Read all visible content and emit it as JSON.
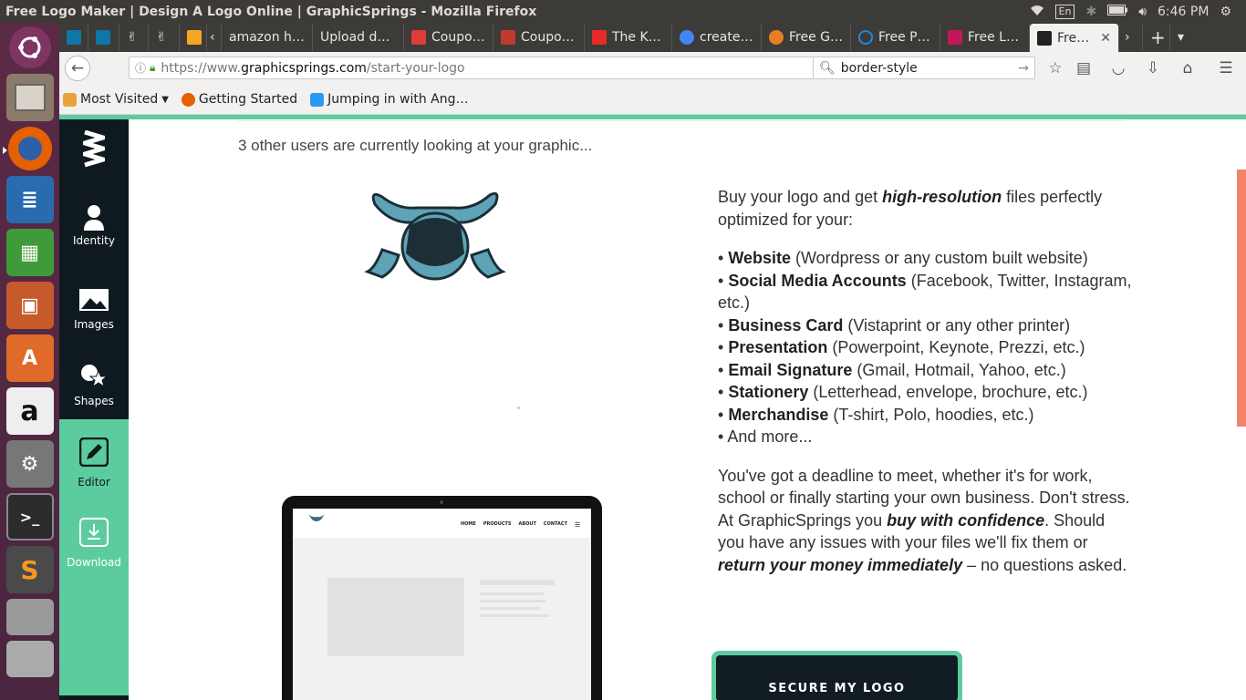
{
  "panel": {
    "window_title": "Free Logo Maker | Design A Logo Online | GraphicSprings - Mozilla Firefox",
    "keyboard": "En",
    "time": "6:46 PM"
  },
  "tabs": [
    {
      "label": "",
      "color": "#0e76a8"
    },
    {
      "label": "",
      "color": "#0e76a8"
    },
    {
      "label": "",
      "color": "#555"
    },
    {
      "label": "",
      "color": "#555"
    },
    {
      "label": "",
      "color": "#f5a623"
    },
    {
      "label": "amazon h…",
      "color": "#333"
    },
    {
      "label": "Upload d…",
      "color": "#333"
    },
    {
      "label": "Coupo…",
      "color": "#e03b3b"
    },
    {
      "label": "Coupo…",
      "color": "#c0392b"
    },
    {
      "label": "The K…",
      "color": "#e52d27"
    },
    {
      "label": "create…",
      "color": "#4285f4"
    },
    {
      "label": "Free G…",
      "color": "#e67e22"
    },
    {
      "label": "Free P…",
      "color": "#1e88e5"
    },
    {
      "label": "Free L…",
      "color": "#c2185b"
    },
    {
      "label": "Fre…",
      "color": "#222"
    }
  ],
  "nav": {
    "url_prefix": "https://www.",
    "url_domain": "graphicsprings.com",
    "url_path": "/start-your-logo",
    "search_value": "border-style"
  },
  "bookmarks": {
    "most_visited": "Most Visited",
    "getting_started": "Getting Started",
    "angular": "Jumping in with Ang…"
  },
  "sidebar": {
    "identity": "Identity",
    "images": "Images",
    "shapes": "Shapes",
    "editor": "Editor",
    "download": "Download"
  },
  "content": {
    "viewers": "3 other users are currently looking at your graphic...",
    "intro_1": "Buy your logo and get ",
    "intro_bold": "high-resolution",
    "intro_2": " files perfectly optimized for your:",
    "features": [
      {
        "bold": "Website",
        "rest": " (Wordpress or any custom built website)"
      },
      {
        "bold": "Social Media Accounts",
        "rest": " (Facebook, Twitter, Instagram, etc.)"
      },
      {
        "bold": "Business Card",
        "rest": " (Vistaprint or any other printer)"
      },
      {
        "bold": "Presentation",
        "rest": " (Powerpoint, Keynote, Prezzi, etc.)"
      },
      {
        "bold": "Email Signature",
        "rest": " (Gmail, Hotmail, Yahoo, etc.)"
      },
      {
        "bold": "Stationery",
        "rest": " (Letterhead, envelope, brochure, etc.)"
      },
      {
        "bold": "Merchandise",
        "rest": " (T-shirt, Polo, hoodies, etc.)"
      },
      {
        "bold": "",
        "rest": "And more..."
      }
    ],
    "deadline_1": "You've got a deadline to meet, whether it's for work, school or finally starting your own business. Don't stress. At GraphicSprings you ",
    "deadline_b1": "buy with confidence",
    "deadline_2": ". Should you have any issues with your files we'll fix them or ",
    "deadline_b2": "return your money immediately",
    "deadline_3": " – no questions asked.",
    "cta": "SECURE MY LOGO",
    "mock_nav": [
      "HOME",
      "PRODUCTS",
      "ABOUT",
      "CONTACT"
    ]
  },
  "colors": {
    "accent_green": "#5ccc9e",
    "sidebar_dark": "#0f1a20",
    "scroll_orange": "#f0836a",
    "logo_blue": "#5fa3b7"
  }
}
